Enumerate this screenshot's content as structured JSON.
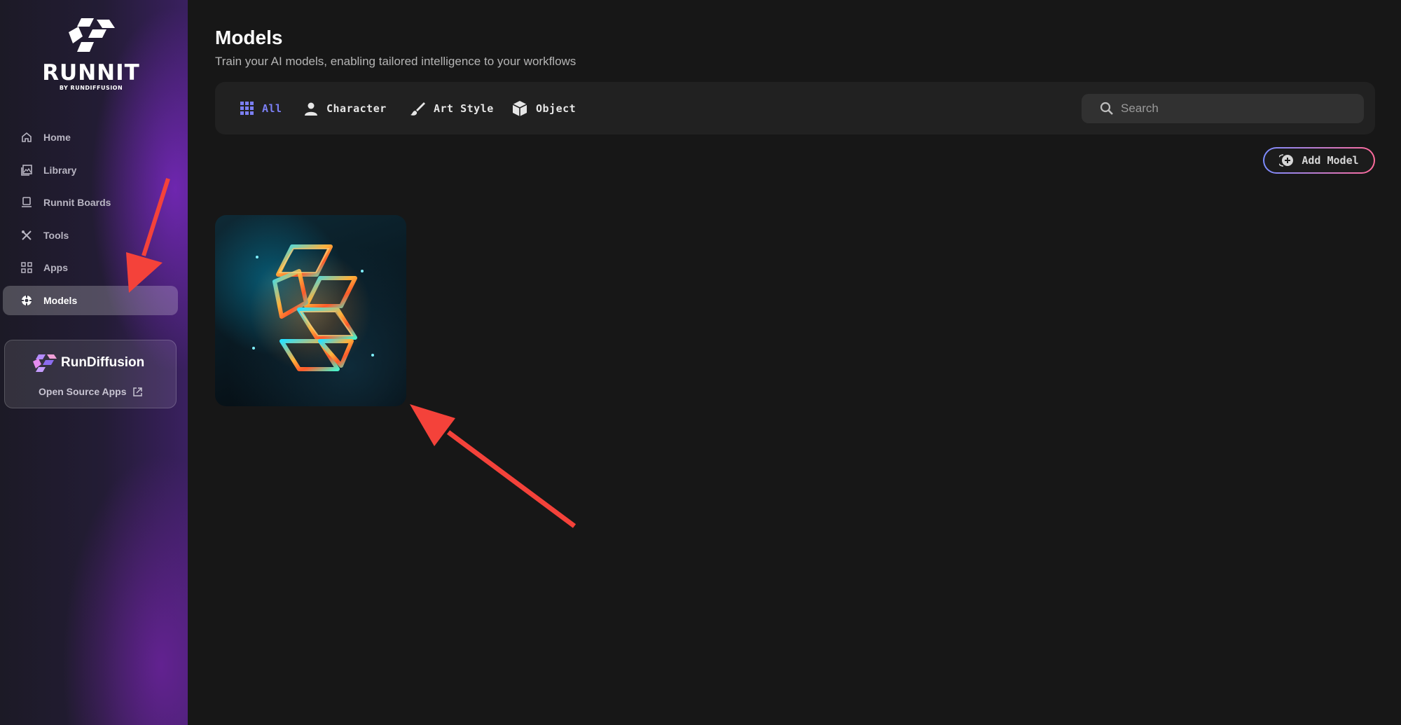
{
  "brand": {
    "logo_word": "RUNNIT",
    "logo_sub": "BY RUNDIFFUSION"
  },
  "sidebar": {
    "items": [
      {
        "label": "Home",
        "icon": "home-icon"
      },
      {
        "label": "Library",
        "icon": "image-library-icon"
      },
      {
        "label": "Runnit Boards",
        "icon": "board-icon"
      },
      {
        "label": "Tools",
        "icon": "tools-icon"
      },
      {
        "label": "Apps",
        "icon": "apps-grid-icon"
      },
      {
        "label": "Models",
        "icon": "models-icon",
        "active": true
      }
    ],
    "promo": {
      "title": "RunDiffusion",
      "link_label": "Open Source Apps"
    }
  },
  "header": {
    "title": "Models",
    "subtitle": "Train your AI models, enabling tailored intelligence to your workflows"
  },
  "filters": {
    "tabs": [
      {
        "label": "All",
        "icon": "grid-icon",
        "active": true
      },
      {
        "label": "Character",
        "icon": "person-icon"
      },
      {
        "label": "Art Style",
        "icon": "brush-icon"
      },
      {
        "label": "Object",
        "icon": "cube-icon"
      }
    ],
    "search_placeholder": "Search"
  },
  "actions": {
    "add_model_label": "Add Model"
  },
  "colors": {
    "accent": "#7b7ff5",
    "background": "#171717",
    "annotation_arrow": "#f4423a"
  }
}
